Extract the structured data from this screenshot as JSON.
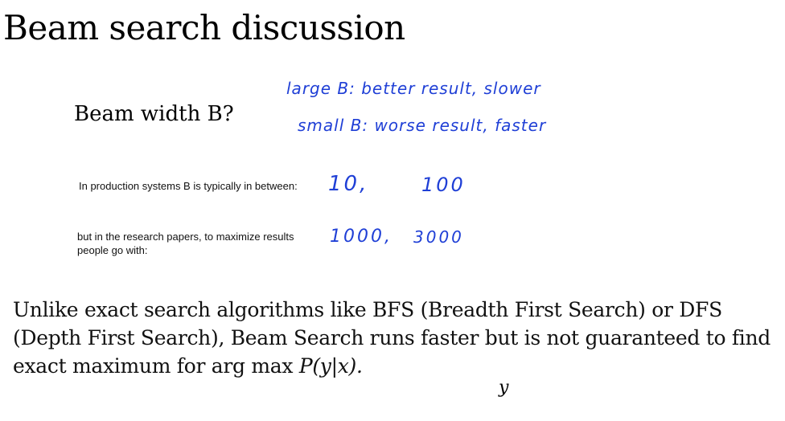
{
  "slide": {
    "title": "Beam search discussion",
    "question": "Beam width B?",
    "handwriting": {
      "line1": "large B: better result, slower",
      "line2": "small B: worse result, faster",
      "prod_low": "10,",
      "prod_high": "100",
      "research_low": "1000,",
      "research_high": "3000"
    },
    "notes": {
      "production": "In production systems B is typically in between:",
      "research": "but in the research papers, to maximize results people go with:"
    },
    "paragraph": {
      "text": "Unlike exact search algorithms like BFS (Breadth First Search) or DFS (Depth First Search), Beam Search runs faster but is not guaranteed to find exact maximum for arg max ",
      "math": "P(y|x).",
      "subscript": "y"
    }
  }
}
